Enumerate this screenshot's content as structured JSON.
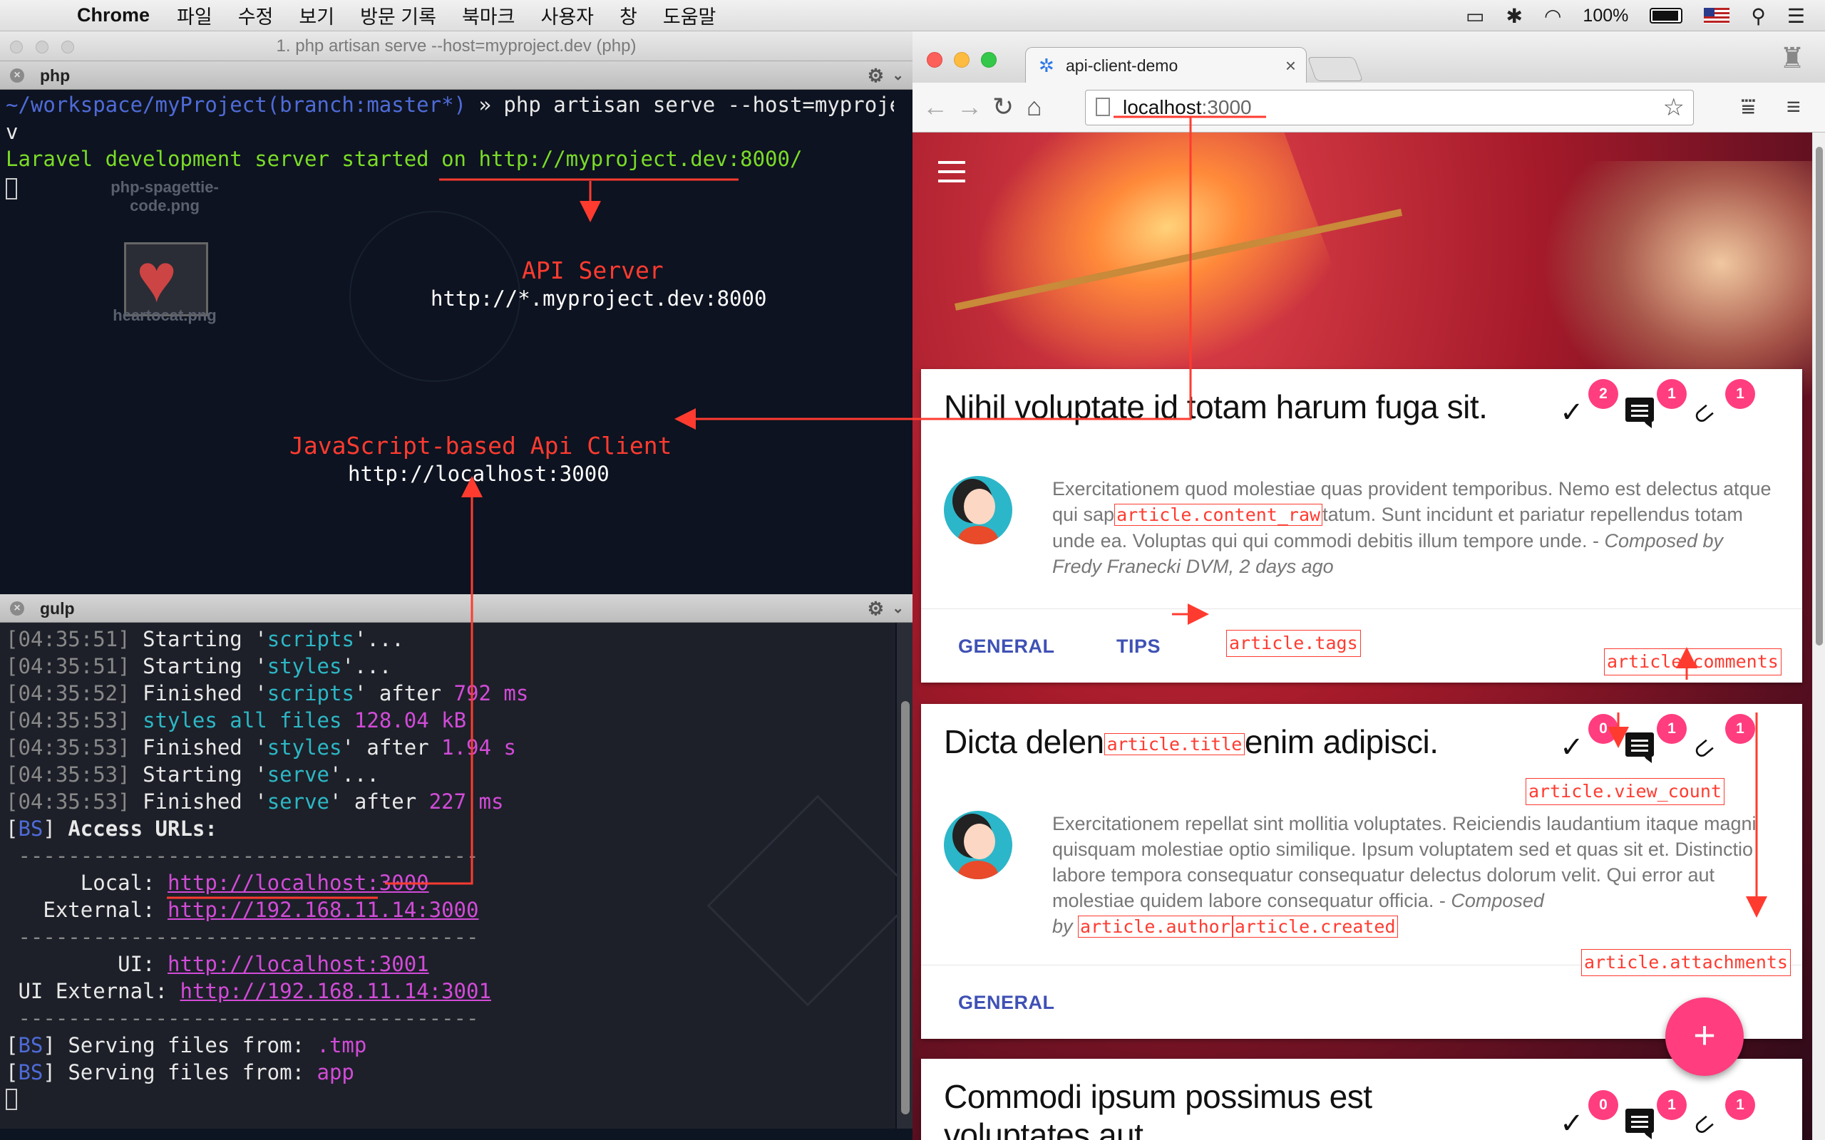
{
  "menubar": {
    "app": "Chrome",
    "items": [
      "파일",
      "수정",
      "보기",
      "방문 기록",
      "북마크",
      "사용자",
      "창",
      "도움말"
    ],
    "battery": "100%"
  },
  "terminal": {
    "window_title": "1. php artisan serve --host=myproject.dev (php)",
    "top_pane": {
      "name": "php",
      "prompt_path": "~/workspace/myProject",
      "prompt_branch": "(branch:master*)",
      "prompt_sep": " » ",
      "command": "php artisan serve --host=myproject.de",
      "command_wrap": "v",
      "output_prefix": "Laravel development server started on ",
      "output_url": "http://myproject.dev:8000/"
    },
    "desktop_icons": {
      "file1a": "php-spagettie-",
      "file1b": "code.png",
      "file2": "heartocat.png"
    },
    "annotations": {
      "api_title": "API Server",
      "api_url": "http://*.myproject.dev:8000",
      "client_title": "JavaScript-based Api Client",
      "client_url": "http://localhost:3000"
    },
    "bottom_pane": {
      "name": "gulp",
      "lines": [
        {
          "time": "04:35:51",
          "pre": "Starting '",
          "task": "scripts",
          "post": "'..."
        },
        {
          "time": "04:35:51",
          "pre": "Starting '",
          "task": "styles",
          "post": "'..."
        },
        {
          "time": "04:35:52",
          "pre": "Finished '",
          "task": "scripts",
          "post": "' after ",
          "dur": "792 ms"
        },
        {
          "time": "04:35:53",
          "pre": "",
          "task": "styles all files",
          "post": " ",
          "dur": "128.04 kB"
        },
        {
          "time": "04:35:53",
          "pre": "Finished '",
          "task": "styles",
          "post": "' after ",
          "dur": "1.94 s"
        },
        {
          "time": "04:35:53",
          "pre": "Starting '",
          "task": "serve",
          "post": "'..."
        },
        {
          "time": "04:35:53",
          "pre": "Finished '",
          "task": "serve",
          "post": "' after ",
          "dur": "227 ms"
        }
      ],
      "bs_tag": "BS",
      "access_urls": "Access URLs:",
      "separator": " -------------------------------------",
      "local_label": "      Local: ",
      "local_url": "http://localhost:3000",
      "external_label": "   External: ",
      "external_url": "http://192.168.11.14:3000",
      "ui_label": "         UI: ",
      "ui_url": "http://localhost:3001",
      "ui_external_label": " UI External: ",
      "ui_external_url": "http://192.168.11.14:3001",
      "serving1_label": "Serving files from: ",
      "serving1_dir": ".tmp",
      "serving2_label": "Serving files from: ",
      "serving2_dir": "app"
    }
  },
  "chrome": {
    "tab_title": "api-client-demo",
    "url_host": "localhost",
    "url_port": ":3000",
    "articles": [
      {
        "title": "Nihil voluptate id totam harum fuga sit.",
        "badges": {
          "views": "2",
          "comments": "1",
          "attachments": "1"
        },
        "excerpt_a": "Exercitationem quod molestiae quas provident temporibus. Nemo est delectus atque qui sap",
        "excerpt_b": "tatum. Sunt incidunt et pariatur repellendus totam unde ea. Voluptas qui qui commodi debitis illum tempore unde. - ",
        "byline": "Composed by Fredy Franecki DVM, 2 days ago",
        "tags": [
          "GENERAL",
          "TIPS"
        ]
      },
      {
        "title_a": "Dicta delen",
        "title_b": "enim adipisci.",
        "badges": {
          "views": "0",
          "comments": "1",
          "attachments": "1"
        },
        "excerpt": "Exercitationem repellat sint mollitia voluptates. Reiciendis laudantium itaque magni quisquam molestiae optio similique. Ipsum voluptatem sed et quas sit et. Distinctio labore tempora consequatur consequatur delectus dolorum velit. Qui error aut molestiae quidem labore consequatur officia. - ",
        "byline_a": "Composed",
        "byline_b": "by",
        "tags": [
          "GENERAL"
        ]
      },
      {
        "title": "Commodi ipsum possimus est voluptates aut.",
        "badges": {
          "views": "0",
          "comments": "1",
          "attachments": "1"
        }
      }
    ],
    "labels": {
      "content_raw": "article.content_raw",
      "tags": "article.tags",
      "comments": "article.comments",
      "title": "article.title",
      "view_count": "article.view_count",
      "author": "article.author",
      "created": "article.created",
      "attachments": "article.attachments"
    },
    "fab": "+"
  }
}
